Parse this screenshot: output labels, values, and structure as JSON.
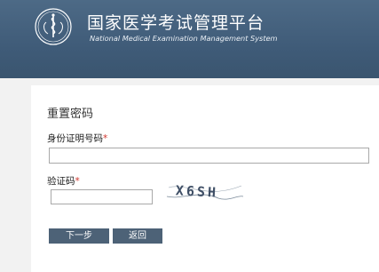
{
  "header": {
    "title_cn": "国家医学考试管理平台",
    "title_en": "National Medical Examination Management System",
    "logo_icon": "medical-exam-emblem-icon"
  },
  "form": {
    "title": "重置密码",
    "id_label": "身份证明号码",
    "id_value": "",
    "code_label": "验证码",
    "code_value": "",
    "required_mark": "*",
    "captcha_text": "X6SH"
  },
  "buttons": {
    "next": "下一步",
    "back": "返回"
  },
  "colors": {
    "header": "#3f5b78",
    "button": "#4d6277",
    "required": "#d0342c"
  }
}
